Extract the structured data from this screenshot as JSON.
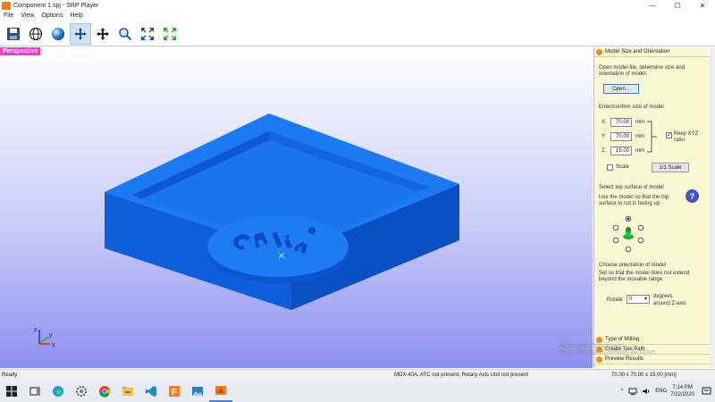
{
  "window": {
    "title": "Component 1.spj - SRP Player",
    "minimize": "—",
    "maximize": "☐",
    "close": "✕"
  },
  "menu": [
    "File",
    "View",
    "Options",
    "Help"
  ],
  "toolbar": {
    "icons": [
      "save-icon",
      "globe-icon",
      "sphere-render-icon",
      "pan-view-icon",
      "move-icon",
      "zoom-icon",
      "fit-view-icon",
      "fit-selection-icon"
    ],
    "active_index": 3
  },
  "viewport": {
    "label": "Perspective",
    "axes": {
      "z": "z",
      "x": "x",
      "y": "y"
    }
  },
  "panel": {
    "section1_title": "Model Size and Orientation",
    "open_desc": "Open model file, determine size and orientation of model.",
    "open_button": "Open...",
    "size_desc": "Enter/confirm size of model",
    "x_label": "X:",
    "x_value": "70.00",
    "x_unit": "mm",
    "y_label": "Y:",
    "y_value": "70.00",
    "y_unit": "mm",
    "z_label": "Z:",
    "z_value": "15.00",
    "z_unit": "mm",
    "keep_ratio": "Keep XYZ ratio",
    "scale_label": "Scale",
    "scale_button": "1/1 Scale",
    "top_surface_title": "Select top surface of model",
    "top_surface_desc": "Use the model so that the top surface to cut is facing up.",
    "orientation_title": "Choose orientation of model",
    "orientation_desc": "Set so that the model does not extend beyond the movable range.",
    "rotate_label": "Rotate",
    "rotate_value": "0",
    "rotate_unit_line1": "degrees",
    "rotate_unit_line2": "around Z-axis",
    "help_label": "?",
    "section2_title": "Type of Milling",
    "section3_title": "Create Tool Path",
    "section4_title": "Preview Results"
  },
  "statusbar": {
    "left": "Ready",
    "middle": "MDX-40A, ATC not present, Rotary Axis Unit not present",
    "right": "70.00 x 70.00 x 15.00 [mm]"
  },
  "watermark": {
    "line1": "Activate Windows",
    "line2": "Go to Settings to activate Windows."
  },
  "taskbar": {
    "icons": [
      "windows-start-icon",
      "task-view-icon",
      "edge-icon",
      "settings-icon",
      "chrome-icon",
      "file-explorer-icon",
      "vscode-icon",
      "foxit-icon",
      "photos-icon",
      "srp-player-icon"
    ],
    "language": "ENG",
    "time": "7:14 PM",
    "date": "7/22/2020",
    "tray_caret": "^"
  },
  "colors": {
    "model_blue": "#1a75f0",
    "model_dark": "#0d58d6",
    "label_pink": "#ff39c4",
    "panel_bg": "#fbf8d4"
  }
}
